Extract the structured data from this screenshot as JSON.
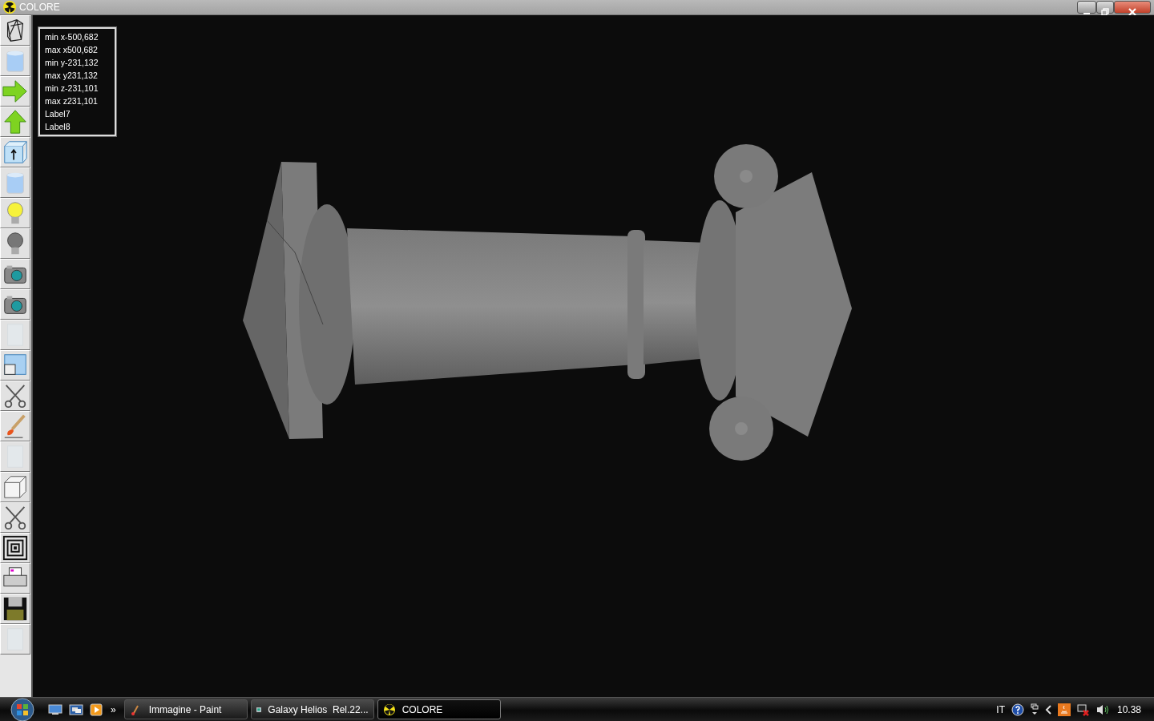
{
  "window": {
    "title": "COLORE"
  },
  "toolbar": [
    {
      "kind": "wireframe",
      "disabled": false
    },
    {
      "kind": "cylinder",
      "disabled": false
    },
    {
      "kind": "arrow-right",
      "disabled": false
    },
    {
      "kind": "arrow-up",
      "disabled": false
    },
    {
      "kind": "box-arrow",
      "disabled": false
    },
    {
      "kind": "cylinder",
      "disabled": false
    },
    {
      "kind": "bulb-on",
      "disabled": false
    },
    {
      "kind": "bulb-off",
      "disabled": false
    },
    {
      "kind": "camera",
      "disabled": false
    },
    {
      "kind": "camera",
      "disabled": false
    },
    {
      "kind": "blank",
      "disabled": true
    },
    {
      "kind": "window",
      "disabled": false
    },
    {
      "kind": "scissors",
      "disabled": false
    },
    {
      "kind": "brush",
      "disabled": false
    },
    {
      "kind": "blank",
      "disabled": true
    },
    {
      "kind": "cube",
      "disabled": false
    },
    {
      "kind": "scissors",
      "disabled": false
    },
    {
      "kind": "squares",
      "disabled": false
    },
    {
      "kind": "printer",
      "disabled": false
    },
    {
      "kind": "floppy",
      "disabled": false
    },
    {
      "kind": "blank",
      "disabled": true
    }
  ],
  "info_labels": [
    "min x-500,682",
    "max x500,682",
    "min y-231,132",
    "max y231,132",
    "min z-231,101",
    "max z231,101",
    "Label7",
    "Label8"
  ],
  "taskbar": {
    "overflow": "»",
    "tasks": [
      {
        "label": "Immagine - Paint",
        "kind": "paint",
        "selected": false
      },
      {
        "label": "Galaxy Helios  Rel.22...",
        "kind": "helios",
        "selected": false
      },
      {
        "label": "COLORE",
        "kind": "colore",
        "selected": true
      }
    ],
    "language": "IT",
    "clock": "10.38"
  }
}
